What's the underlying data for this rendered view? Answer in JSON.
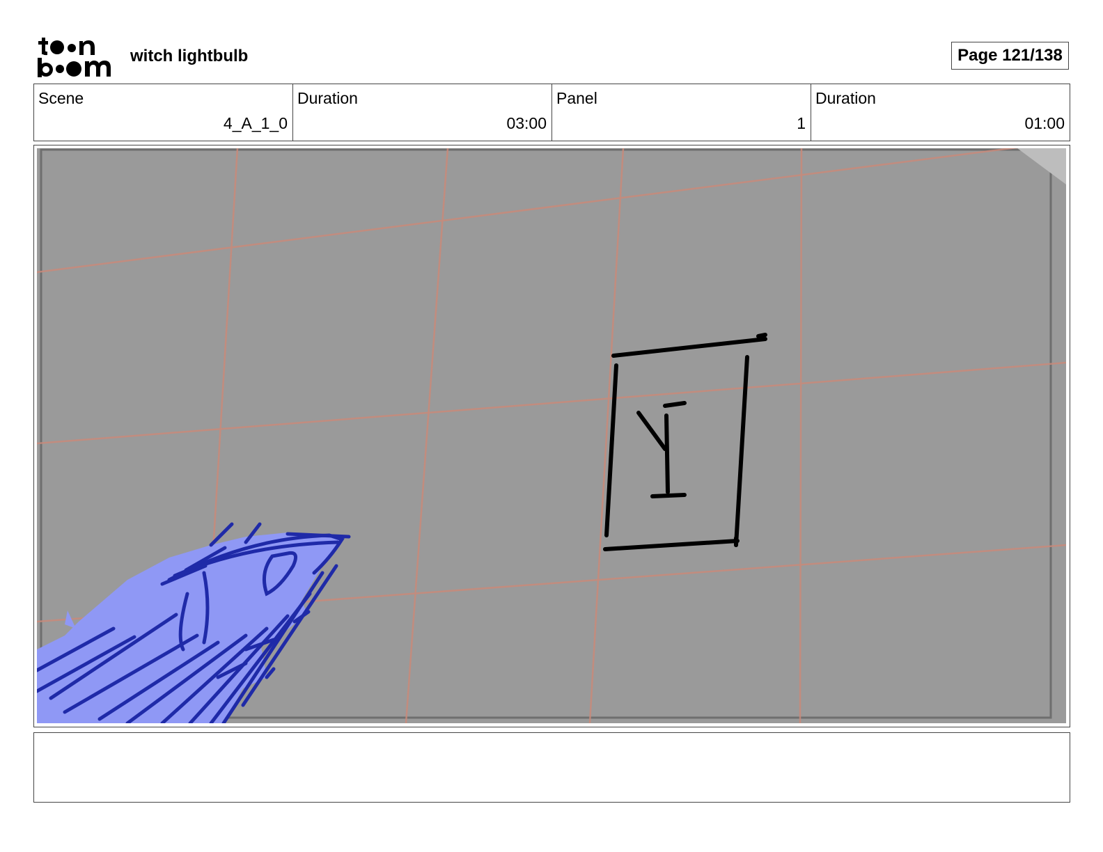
{
  "header": {
    "logo_text": "toon boom",
    "project_title": "witch lightbulb",
    "page_label": "Page 121/138"
  },
  "info": {
    "scene_label": "Scene",
    "scene_value": "4_A_1_0",
    "scene_duration_label": "Duration",
    "scene_duration_value": "03:00",
    "panel_label": "Panel",
    "panel_value": "1",
    "panel_duration_label": "Duration",
    "panel_duration_value": "01:00"
  },
  "panel": {
    "background_color": "#9a9a9a",
    "grid_color": "#c98a7a",
    "sketch_fill_color": "#8f98f5",
    "sketch_line_color": "#1f2aa8",
    "ink_color": "#000000"
  },
  "notes": {
    "text": ""
  }
}
